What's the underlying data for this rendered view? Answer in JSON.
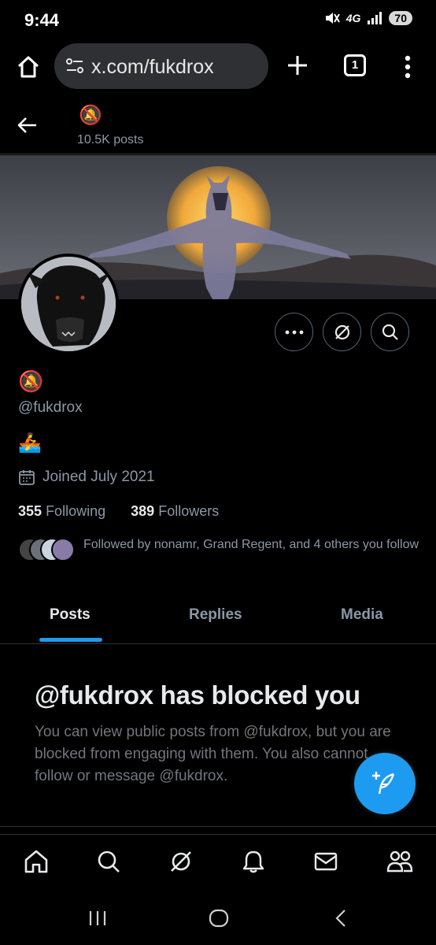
{
  "status_bar": {
    "time": "9:44",
    "network": "4G",
    "battery": "70"
  },
  "browser": {
    "url": "x.com/fukdrox",
    "tab_count": "1"
  },
  "header": {
    "name_emoji": "🔕",
    "post_count": "10.5K posts"
  },
  "profile": {
    "display_name_emoji": "🔕",
    "handle": "@fukdrox",
    "bio_emoji": "🚣",
    "joined": "Joined July 2021",
    "following_count": "355",
    "following_label": "Following",
    "followers_count": "389",
    "followers_label": "Followers",
    "followed_by": "Followed by nonamr, Grand Regent, and 4 others you follow"
  },
  "tabs": [
    {
      "label": "Posts",
      "active": true
    },
    {
      "label": "Replies",
      "active": false
    },
    {
      "label": "Media",
      "active": false
    }
  ],
  "blocked": {
    "title": "@fukdrox has blocked you",
    "description": "You can view public posts from @fukdrox, but you are blocked from engaging with them. You also cannot follow or message @fukdrox."
  },
  "colors": {
    "accent": "#1d9bf0",
    "background": "#000000",
    "secondary_text": "#71767b"
  },
  "icons": {
    "home": "home-icon",
    "search": "search-icon",
    "grok": "grok-icon",
    "notifications": "bell-icon",
    "messages": "mail-icon",
    "communities": "people-icon",
    "compose": "compose-icon"
  }
}
